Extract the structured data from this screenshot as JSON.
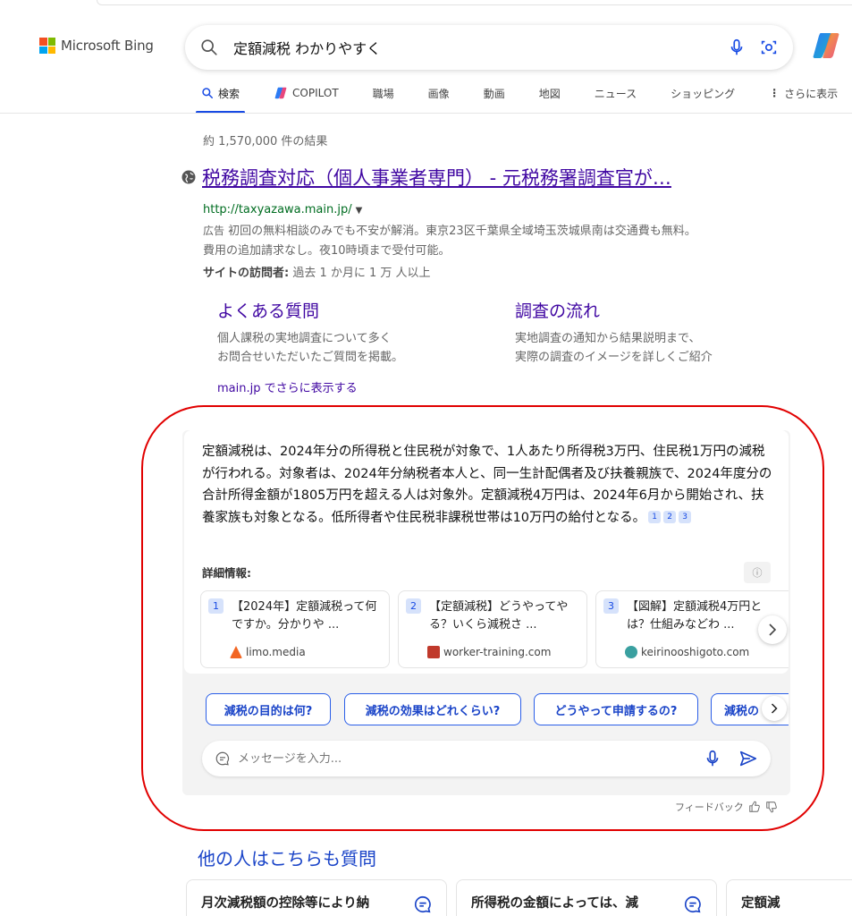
{
  "header": {
    "logo_text": "Microsoft Bing",
    "query": "定額減税 わかりやすく"
  },
  "tabs": [
    {
      "label": "検索"
    },
    {
      "label": "COPILOT"
    },
    {
      "label": "職場"
    },
    {
      "label": "画像"
    },
    {
      "label": "動画"
    },
    {
      "label": "地図"
    },
    {
      "label": "ニュース"
    },
    {
      "label": "ショッピング"
    },
    {
      "label": "さらに表示"
    }
  ],
  "results_count": "約 1,570,000 件の結果",
  "ad": {
    "title": "税務調査対応（個人事業者専門） - 元税務署調査官が…",
    "url": "http://taxyazawa.main.jp/",
    "tag": "広告",
    "description_line1": "初回の無料相談のみでも不安が解消。東京23区千葉県全域埼玉茨城県南は交通費も無料。",
    "description_line2": "費用の追加請求なし。夜10時頃まで受付可能。",
    "visit_label": "サイトの訪問者:",
    "visit_value": "過去 1 か月に 1 万 人以上",
    "sitelinks": [
      {
        "title": "よくある質問",
        "line1": "個人課税の実地調査について多く",
        "line2": "お問合せいただいたご質問を掲載。"
      },
      {
        "title": "調査の流れ",
        "line1": "実地調査の通知から結果説明まで、",
        "line2": "実際の調査のイメージを詳しくご紹介"
      }
    ],
    "more_link": "main.jp でさらに表示する"
  },
  "ai_answer": {
    "text": "定額減税は、2024年分の所得税と住民税が対象で、1人あたり所得税3万円、住民税1万円の減税が行われる。対象者は、2024年分納税者本人と、同一生計配偶者及び扶養親族で、2024年度分の合計所得金額が1805万円を超える人は対象外。定額減税4万円は、2024年6月から開始され、扶養家族も対象となる。低所得者や住民税非課税世帯は10万円の給付となる。",
    "citations": [
      "1",
      "2",
      "3"
    ],
    "details_label": "詳細情報:",
    "sources": [
      {
        "num": "1",
        "title": "【2024年】定額減税って何ですか。分かりや ...",
        "site": "limo.media",
        "fav_color": "#f26522"
      },
      {
        "num": "2",
        "title": "【定額減税】どうやってやる？いくら減税さ ...",
        "site": "worker-training.com",
        "fav_color": "#c0392b"
      },
      {
        "num": "3",
        "title": "【図解】定額減税4万円とは？仕組みなどわ ...",
        "site": "keirinooshigoto.com",
        "fav_color": "#3aa0a0"
      }
    ],
    "suggestions": [
      "減税の目的は何?",
      "減税の効果はどれくらい?",
      "どうやって申請するの?",
      "減税の"
    ],
    "message_placeholder": "メッセージを入力...",
    "feedback_label": "フィードバック"
  },
  "people_also_ask": {
    "title": "他の人はこちらも質問",
    "questions": [
      "月次減税額の控除等により納",
      "所得税の金額によっては、減",
      "定額減"
    ]
  },
  "colors": {
    "link_purple": "#4007a2",
    "accent_blue": "#174ae4",
    "url_green": "#006d21",
    "highlight_red": "#e10000"
  }
}
